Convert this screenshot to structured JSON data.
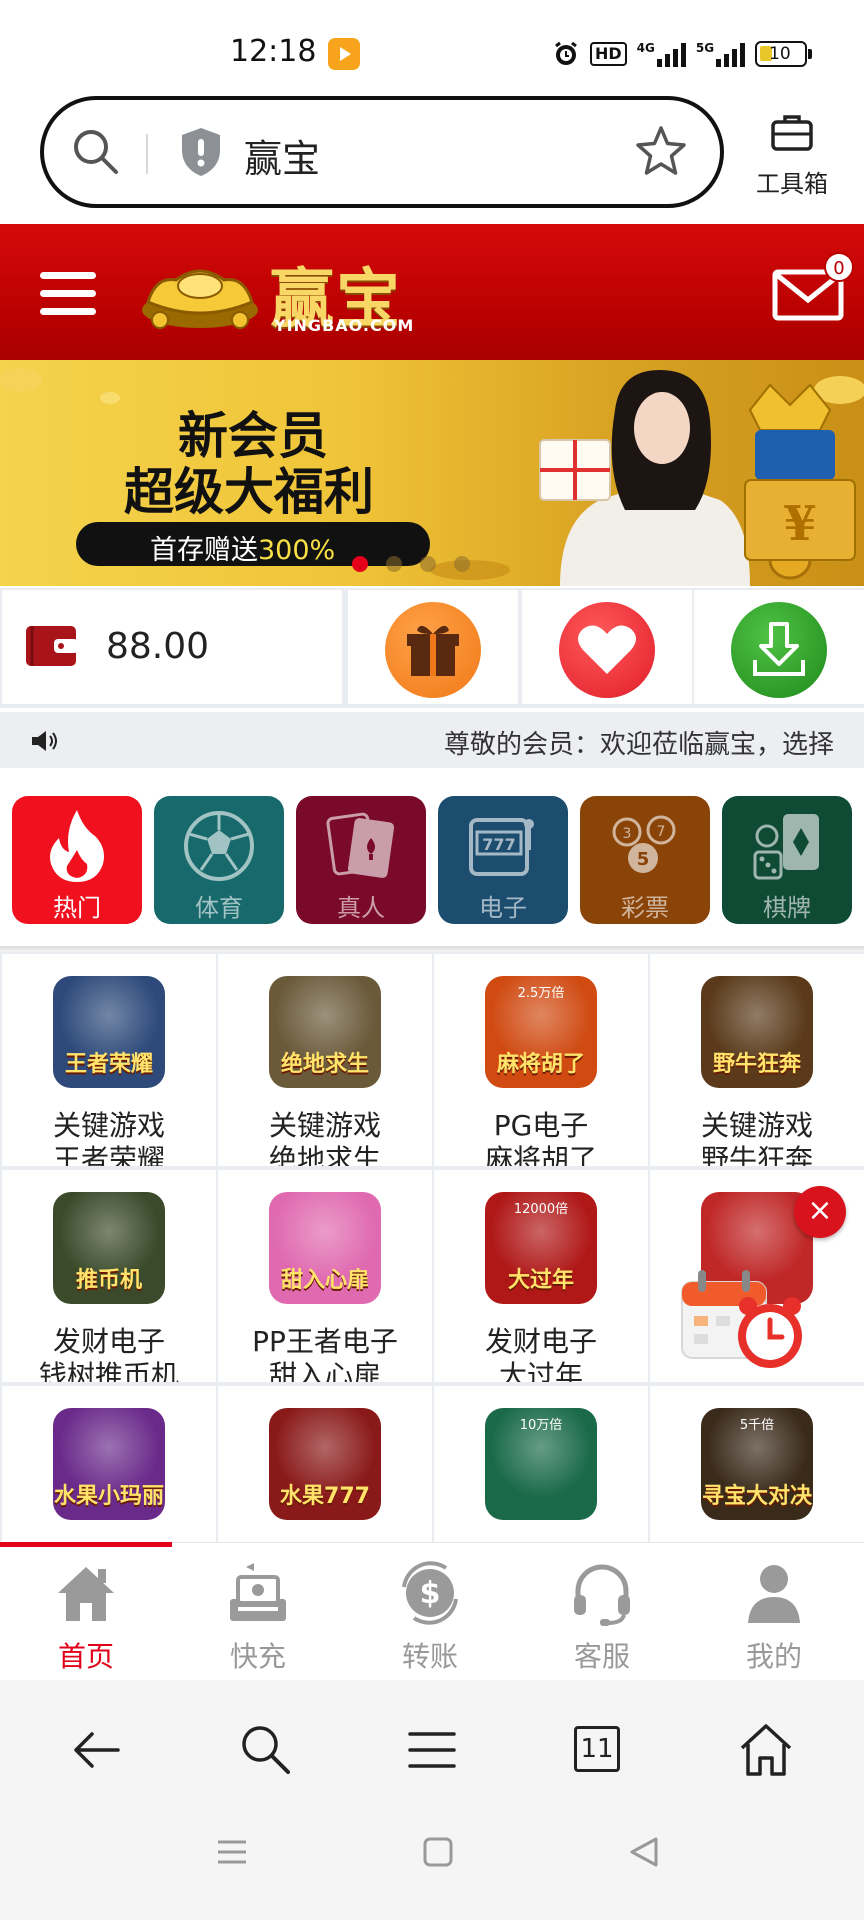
{
  "status_bar": {
    "time": "12:18",
    "hd_label": "HD",
    "net_4g": "4G",
    "net_5g": "5G",
    "battery": "10"
  },
  "browser": {
    "url_text": "赢宝",
    "toolbox_label": "工具箱"
  },
  "site": {
    "logo_text": "赢宝",
    "logo_domain": "YINGBAO.COM",
    "mail_count": "0"
  },
  "banner": {
    "line1": "新会员",
    "line2": "超级大福利",
    "pill_prefix": "首存赠送",
    "pill_highlight": "300%",
    "active_slide": 1,
    "slide_count": 4
  },
  "wallet": {
    "balance": "88.00",
    "quick_actions": [
      {
        "icon": "gift-icon",
        "color": "#f58426"
      },
      {
        "icon": "heart-icon",
        "color": "#ee2a3a"
      },
      {
        "icon": "download-icon",
        "color": "#2f9c2a"
      }
    ]
  },
  "marquee": {
    "text": "尊敬的会员：欢迎莅临赢宝，选择"
  },
  "categories": [
    {
      "label": "热门",
      "icon": "flame-icon",
      "color": "#f0101e",
      "active": true
    },
    {
      "label": "体育",
      "icon": "soccer-ball-icon",
      "color": "#17696b",
      "active": false
    },
    {
      "label": "真人",
      "icon": "playing-cards-icon",
      "color": "#7a0a2a",
      "active": false
    },
    {
      "label": "电子",
      "icon": "slot-machine-icon",
      "color": "#1c4d6e",
      "active": false
    },
    {
      "label": "彩票",
      "icon": "lottery-balls-icon",
      "color": "#8a4408",
      "active": false
    },
    {
      "label": "棋牌",
      "icon": "chess-card-icon",
      "color": "#0f4a35",
      "active": false
    }
  ],
  "games": [
    {
      "line1": "关键游戏",
      "line2": "王者荣耀",
      "thumb_caption": "王者荣耀",
      "thumb_color": "#2d4a7a"
    },
    {
      "line1": "关键游戏",
      "line2": "绝地求生",
      "thumb_caption": "绝地求生",
      "thumb_color": "#6a5a3a"
    },
    {
      "line1": "PG电子",
      "line2": "麻将胡了",
      "thumb_caption": "麻将胡了",
      "thumb_color": "#d04a12",
      "thumb_tag": "2.5万倍"
    },
    {
      "line1": "关键游戏",
      "line2": "野牛狂奔",
      "thumb_caption": "野牛狂奔",
      "thumb_color": "#5a3a1a"
    },
    {
      "line1": "发财电子",
      "line2": "钱树推币机",
      "thumb_caption": "推币机",
      "thumb_color": "#3a4a2a"
    },
    {
      "line1": "PP王者电子",
      "line2": "甜入心扉",
      "thumb_caption": "甜入心扉",
      "thumb_color": "#e06ab0"
    },
    {
      "line1": "发财电子",
      "line2": "大过年",
      "thumb_caption": "大过年",
      "thumb_color": "#b01818",
      "thumb_tag": "12000倍"
    },
    {
      "line1": "",
      "line2": "",
      "thumb_caption": "",
      "thumb_color": "#c02828"
    },
    {
      "line1": "",
      "line2": "",
      "thumb_caption": "水果小玛丽",
      "thumb_color": "#6a2a8a"
    },
    {
      "line1": "",
      "line2": "",
      "thumb_caption": "水果777",
      "thumb_color": "#8a1a1a"
    },
    {
      "line1": "",
      "line2": "",
      "thumb_caption": "",
      "thumb_color": "#1a6a4a",
      "thumb_tag": "10万倍"
    },
    {
      "line1": "",
      "line2": "",
      "thumb_caption": "寻宝大对决",
      "thumb_color": "#3a2a1a",
      "thumb_tag": "5千倍"
    }
  ],
  "float_ad": {
    "close_label": "×"
  },
  "app_nav": [
    {
      "label": "首页",
      "icon": "home-icon",
      "active": true
    },
    {
      "label": "快充",
      "icon": "cash-deposit-icon",
      "active": false
    },
    {
      "label": "转账",
      "icon": "dollar-transfer-icon",
      "active": false
    },
    {
      "label": "客服",
      "icon": "headset-icon",
      "active": false
    },
    {
      "label": "我的",
      "icon": "user-icon",
      "active": false
    }
  ],
  "browser_nav": {
    "tab_count": "11"
  },
  "colors": {
    "brand_red": "#c80505",
    "accent_red": "#e3001b",
    "gold": "#f8d766"
  }
}
